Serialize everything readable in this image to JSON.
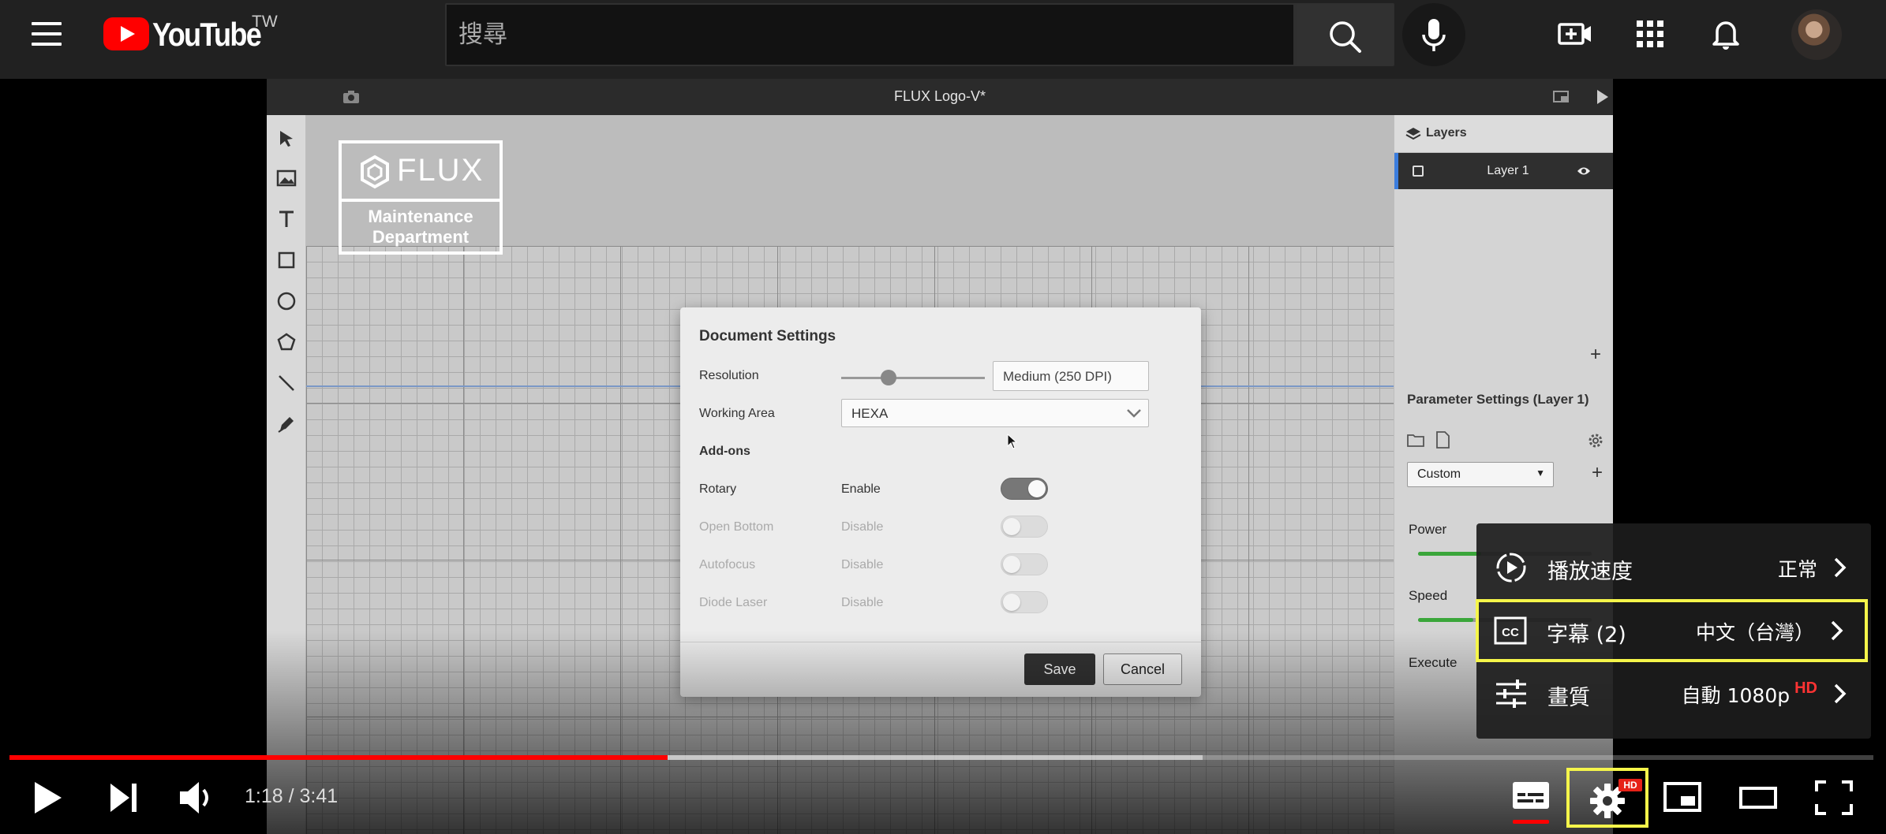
{
  "header": {
    "brand": "YouTube",
    "region": "TW",
    "search_placeholder": "搜尋"
  },
  "video": {
    "app_title": "FLUX Logo-V*",
    "logo_text": "FLUX",
    "logo_sub_1": "Maintenance",
    "logo_sub_2": "Department",
    "layers": {
      "title": "Layers",
      "items": [
        "Layer 1"
      ]
    },
    "parameters": {
      "title": "Parameter Settings (Layer 1)",
      "preset": "Custom",
      "power_label": "Power",
      "speed_label": "Speed",
      "execute_label": "Execute"
    },
    "dialog": {
      "title": "Document Settings",
      "resolution_label": "Resolution",
      "resolution_value": "Medium (250 DPI)",
      "working_area_label": "Working Area",
      "working_area_value": "HEXA",
      "addons_label": "Add-ons",
      "rows": [
        {
          "label": "Rotary",
          "state": "Enable",
          "on": true
        },
        {
          "label": "Open Bottom",
          "state": "Disable",
          "on": false
        },
        {
          "label": "Autofocus",
          "state": "Disable",
          "on": false
        },
        {
          "label": "Diode Laser",
          "state": "Disable",
          "on": false
        }
      ],
      "save_label": "Save",
      "cancel_label": "Cancel"
    }
  },
  "settings_menu": {
    "items": [
      {
        "label": "播放速度",
        "value": "正常",
        "icon": "playback-speed-icon"
      },
      {
        "label": "字幕 (2)",
        "value": "中文（台灣）",
        "icon": "subtitles-icon"
      },
      {
        "label": "畫質",
        "value": "自動 1080p",
        "badge": "HD",
        "icon": "quality-sliders-icon"
      }
    ]
  },
  "player": {
    "current_time": "1:18",
    "duration": "3:41",
    "time_display": "1:18 / 3:41",
    "progress_fraction": 0.353,
    "buffer_fraction": 0.64,
    "hd_badge": "HD"
  },
  "colors": {
    "progress_played": "#ff0000",
    "highlight": "#f5f54a",
    "header_bg": "#212121"
  }
}
